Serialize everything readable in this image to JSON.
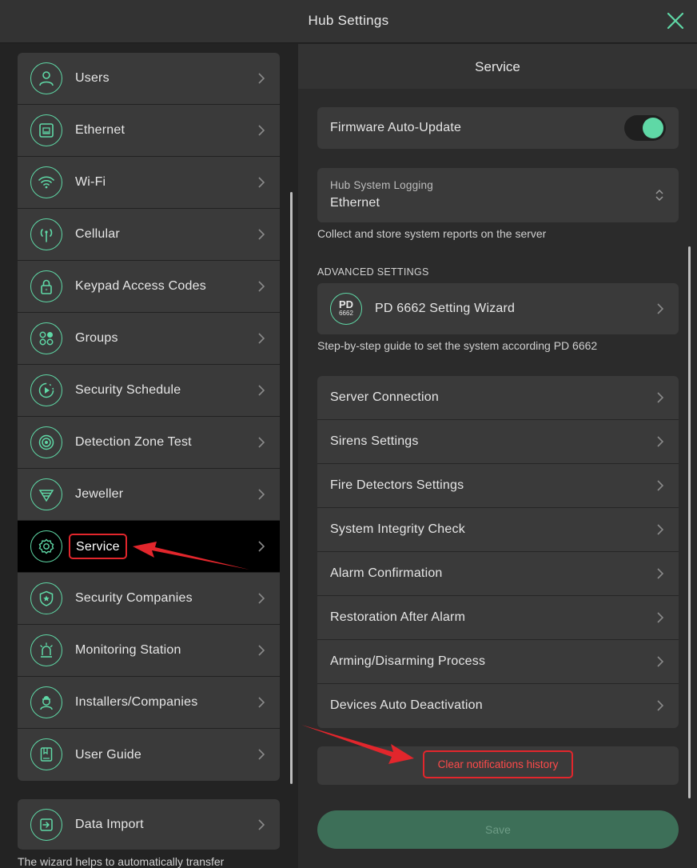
{
  "window": {
    "title": "Hub Settings"
  },
  "sidebar": {
    "items": [
      {
        "label": "Users",
        "icon": "user-icon"
      },
      {
        "label": "Ethernet",
        "icon": "ethernet-icon"
      },
      {
        "label": "Wi-Fi",
        "icon": "wifi-icon"
      },
      {
        "label": "Cellular",
        "icon": "cellular-icon"
      },
      {
        "label": "Keypad Access Codes",
        "icon": "lock-icon"
      },
      {
        "label": "Groups",
        "icon": "groups-icon"
      },
      {
        "label": "Security Schedule",
        "icon": "schedule-icon"
      },
      {
        "label": "Detection Zone Test",
        "icon": "detection-zone-icon"
      },
      {
        "label": "Jeweller",
        "icon": "jeweller-icon"
      },
      {
        "label": "Service",
        "icon": "gear-icon",
        "active": true
      },
      {
        "label": "Security Companies",
        "icon": "shield-star-icon"
      },
      {
        "label": "Monitoring Station",
        "icon": "siren-icon"
      },
      {
        "label": "Installers/Companies",
        "icon": "installer-icon"
      },
      {
        "label": "User Guide",
        "icon": "book-icon"
      }
    ],
    "data_import": {
      "label": "Data Import",
      "icon": "import-icon",
      "description": "The wizard helps to automatically transfer"
    }
  },
  "service": {
    "title": "Service",
    "firmware": {
      "label": "Firmware Auto-Update",
      "enabled": true
    },
    "logging": {
      "caption": "Hub System Logging",
      "value": "Ethernet",
      "note": "Collect and store system reports on the server"
    },
    "advanced": {
      "section": "ADVANCED SETTINGS",
      "wizard": {
        "badge_top": "PD",
        "badge_bottom": "6662",
        "label": "PD 6662 Setting Wizard"
      },
      "note": "Step-by-step guide to set the system according PD 6662"
    },
    "rows": [
      {
        "label": "Server Connection"
      },
      {
        "label": "Sirens Settings"
      },
      {
        "label": "Fire Detectors Settings"
      },
      {
        "label": "System Integrity Check"
      },
      {
        "label": "Alarm Confirmation"
      },
      {
        "label": "Restoration After Alarm"
      },
      {
        "label": "Arming/Disarming Process"
      },
      {
        "label": "Devices Auto Deactivation"
      }
    ],
    "clear_history": "Clear notifications history",
    "save": "Save"
  },
  "colors": {
    "accent": "#5fd8a6",
    "highlight": "#e2262c",
    "save_button": "#3d6f58"
  }
}
